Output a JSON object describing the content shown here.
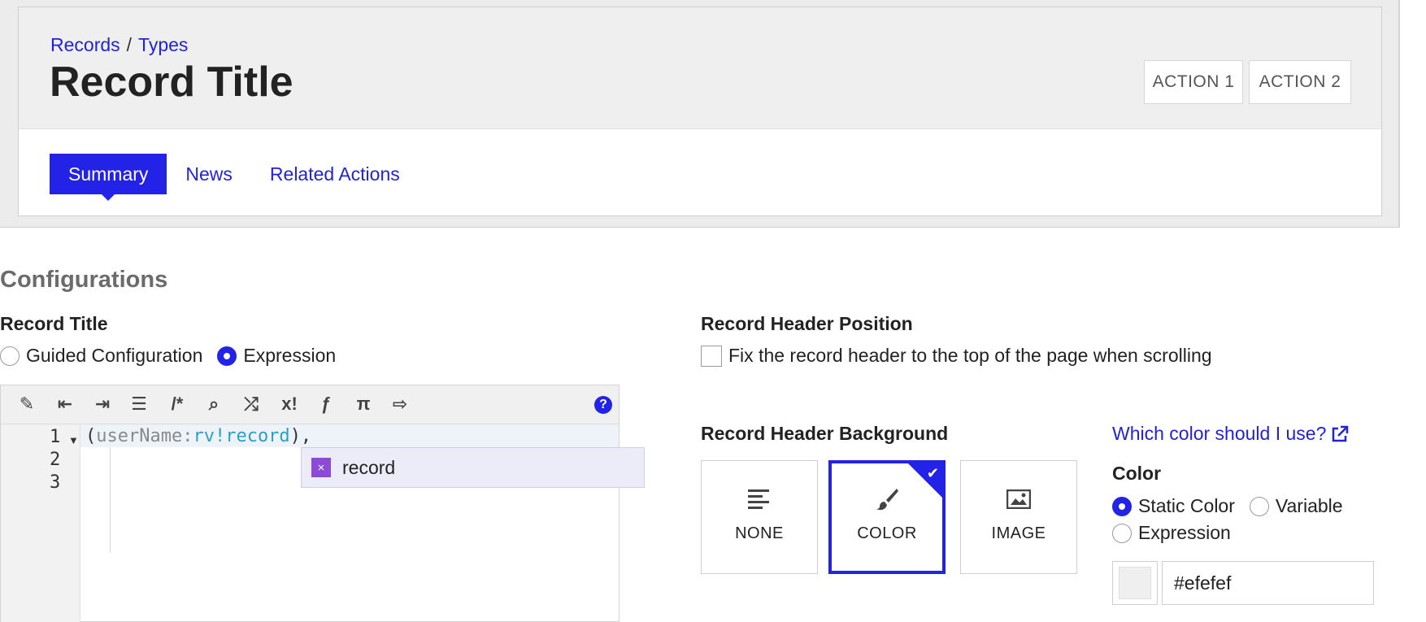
{
  "preview": {
    "breadcrumb": [
      "Records",
      "Types"
    ],
    "breadcrumb_sep": "/",
    "title": "Record Title",
    "actions": [
      "ACTION 1",
      "ACTION 2"
    ],
    "tabs": [
      {
        "label": "Summary",
        "active": true
      },
      {
        "label": "News",
        "active": false
      },
      {
        "label": "Related Actions",
        "active": false
      }
    ]
  },
  "config": {
    "section_title": "Configurations",
    "record_title": {
      "label": "Record Title",
      "options": [
        {
          "label": "Guided Configuration",
          "selected": false
        },
        {
          "label": "Expression",
          "selected": true
        }
      ]
    },
    "header_position": {
      "label": "Record Header Position",
      "checkbox_label": "Fix the record header to the top of the page when scrolling",
      "checked": false
    },
    "editor": {
      "toolbar_icons": [
        "magic-wand-icon",
        "outdent-icon",
        "indent-icon",
        "list-icon",
        "comment-icon",
        "search-icon",
        "shuffle-icon",
        "rule-icon",
        "function-icon",
        "pi-icon",
        "export-icon"
      ],
      "toolbar_glyphs": [
        "✎",
        "⇤",
        "⇥",
        "☰",
        "/*",
        "⌕",
        "⤮",
        "x!",
        "ƒ",
        "π",
        "⇨"
      ],
      "line_numbers": [
        "1",
        "2",
        "3"
      ],
      "code": {
        "open": "(",
        "param": "userName",
        "colon": ":",
        "ref": "rv!record",
        "close": "),"
      },
      "autocomplete": {
        "icon": "×",
        "text": "record"
      }
    },
    "header_background": {
      "label": "Record Header Background",
      "options": [
        {
          "label": "NONE",
          "icon": "align-left-icon",
          "selected": false
        },
        {
          "label": "COLOR",
          "icon": "paintbrush-icon",
          "selected": true
        },
        {
          "label": "IMAGE",
          "icon": "image-icon",
          "selected": false
        }
      ],
      "help_link": "Which color should I use?"
    },
    "color": {
      "label": "Color",
      "options": [
        {
          "label": "Static Color",
          "selected": true
        },
        {
          "label": "Variable",
          "selected": false
        },
        {
          "label": "Expression",
          "selected": false
        }
      ],
      "value": "#efefef",
      "swatch_color": "#efefef"
    }
  },
  "colors": {
    "accent": "#2323e8",
    "link": "#2323d6"
  }
}
